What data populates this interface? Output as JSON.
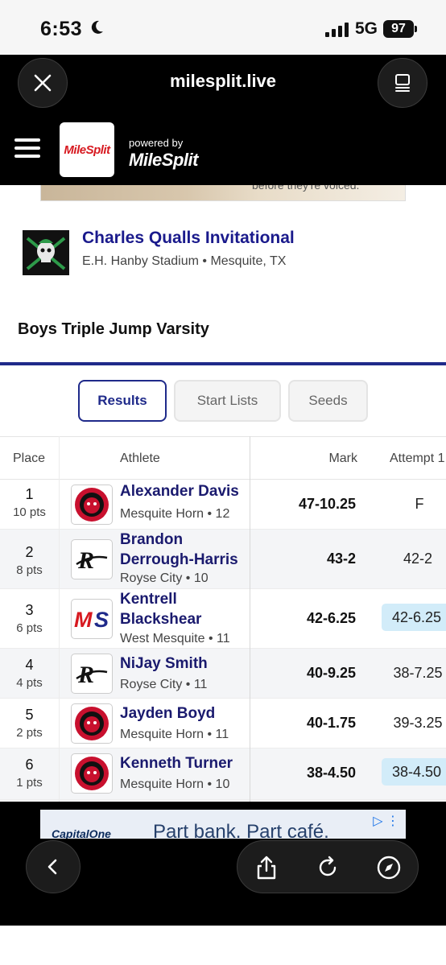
{
  "status_bar": {
    "time": "6:53",
    "network": "5G",
    "battery": "97"
  },
  "browser": {
    "url": "milesplit.live"
  },
  "site_header": {
    "logo": "MileSplit",
    "powered_by": "powered by",
    "powered_brand": "MileSplit"
  },
  "top_ad": {
    "text": "before they're voiced."
  },
  "meet": {
    "title": "Charles Qualls Invitational",
    "location": "E.H. Hanby Stadium • Mesquite, TX"
  },
  "event": {
    "title": "Boys Triple Jump Varsity"
  },
  "tabs": [
    {
      "label": "Results",
      "active": true
    },
    {
      "label": "Start Lists",
      "active": false
    },
    {
      "label": "Seeds",
      "active": false
    }
  ],
  "table": {
    "headers": {
      "place": "Place",
      "athlete": "Athlete",
      "mark": "Mark",
      "attempt": "Attempt 1"
    },
    "rows": [
      {
        "place": "1",
        "pts": "10 pts",
        "name": "Alexander Davis",
        "school": "Mesquite Horn • 12",
        "team_logo": "jaguar-logo",
        "mark": "47-10.25",
        "attempt": "F",
        "highlight": false
      },
      {
        "place": "2",
        "pts": "8 pts",
        "name": "Brandon Derrough-Harris",
        "school": "Royse City • 10",
        "team_logo": "rc-logo",
        "mark": "43-2",
        "attempt": "42-2",
        "highlight": false
      },
      {
        "place": "3",
        "pts": "6 pts",
        "name": "Kentrell Blackshear",
        "school": "West Mesquite • 11",
        "team_logo": "ms-logo",
        "mark": "42-6.25",
        "attempt": "42-6.25",
        "highlight": true
      },
      {
        "place": "4",
        "pts": "4 pts",
        "name": "NiJay Smith",
        "school": "Royse City • 11",
        "team_logo": "rc-logo",
        "mark": "40-9.25",
        "attempt": "38-7.25",
        "highlight": false
      },
      {
        "place": "5",
        "pts": "2 pts",
        "name": "Jayden Boyd",
        "school": "Mesquite Horn • 11",
        "team_logo": "jaguar-logo",
        "mark": "40-1.75",
        "attempt": "39-3.25",
        "highlight": false
      },
      {
        "place": "6",
        "pts": "1 pts",
        "name": "Kenneth Turner",
        "school": "Mesquite Horn • 10",
        "team_logo": "jaguar-logo",
        "mark": "38-4.50",
        "attempt": "38-4.50",
        "highlight": true
      }
    ]
  },
  "bottom_ad": {
    "brand": "CapitalOne",
    "text": "Part bank. Part café."
  },
  "colors": {
    "accent": "#1f2a8a",
    "athlete_link": "#1a1a6e",
    "highlight": "#d2ecf9",
    "logo_red": "#d71920"
  }
}
